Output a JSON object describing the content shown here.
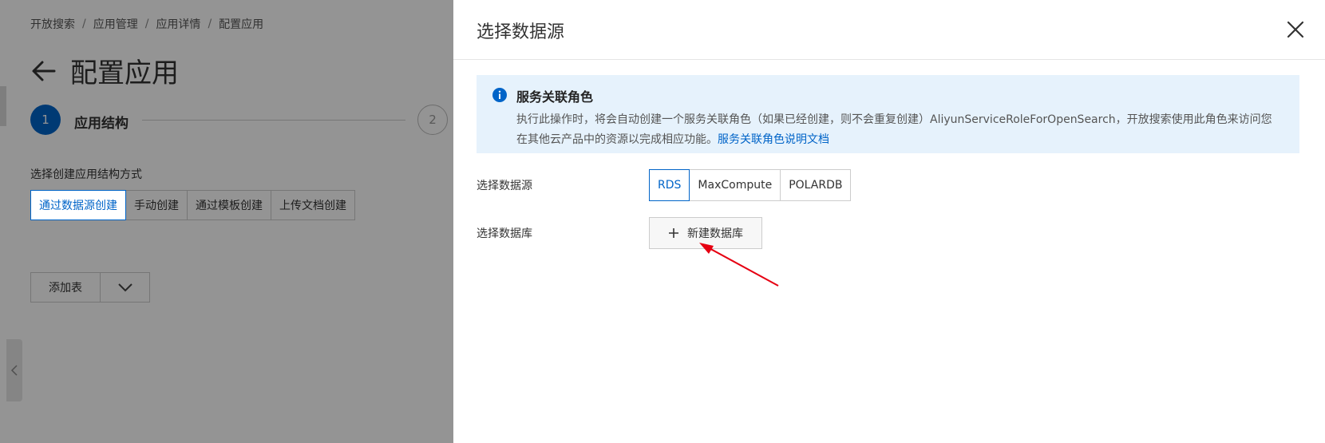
{
  "background": {
    "breadcrumb": [
      "开放搜索",
      "应用管理",
      "应用详情",
      "配置应用"
    ],
    "page_title": "配置应用",
    "steps": [
      {
        "number": "1",
        "label": "应用结构"
      },
      {
        "number": "2",
        "label": ""
      }
    ],
    "create_mode_label": "选择创建应用结构方式",
    "create_modes": [
      "通过数据源创建",
      "手动创建",
      "通过模板创建",
      "上传文档创建"
    ],
    "active_create_mode": "通过数据源创建",
    "add_table_label": "添加表"
  },
  "drawer": {
    "title": "选择数据源",
    "notice": {
      "title": "服务关联角色",
      "body": "执行此操作时，将会自动创建一个服务关联角色（如果已经创建，则不会重复创建）AliyunServiceRoleForOpenSearch，开放搜索使用此角色来访问您在其他云产品中的资源以完成相应功能。",
      "link": "服务关联角色说明文档"
    },
    "datasource_label": "选择数据源",
    "datasource_options": [
      "RDS",
      "MaxCompute",
      "POLARDB"
    ],
    "datasource_selected": "RDS",
    "database_label": "选择数据库",
    "new_database_label": "新建数据库"
  },
  "colors": {
    "primary": "#0064c8",
    "notice_bg": "#e6f2fc",
    "annotation_arrow": "#e60012"
  },
  "icons": [
    "back-arrow-icon",
    "close-icon",
    "info-icon",
    "plus-icon",
    "chevron-down-icon",
    "chevron-left-icon"
  ]
}
